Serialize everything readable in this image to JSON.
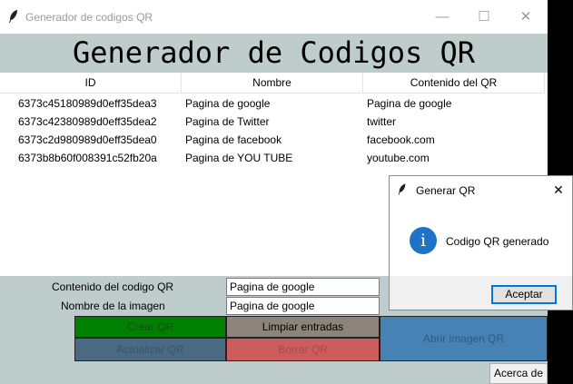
{
  "window": {
    "title": "Generador de codigos QR",
    "controls": {
      "minimize": "—",
      "maximize": "☐",
      "close": "✕"
    }
  },
  "header": {
    "title": "Generador de Codigos QR"
  },
  "table": {
    "columns": [
      "ID",
      "Nombre",
      "Contenido del QR"
    ],
    "rows": [
      [
        "6373c45180989d0eff35dea3",
        "Pagina de google",
        "Pagina de google"
      ],
      [
        "6373c42380989d0eff35dea2",
        "Pagina de Twitter",
        "twitter"
      ],
      [
        "6373c2d980989d0eff35dea0",
        "Pagina de facebook",
        "facebook.com"
      ],
      [
        "6373b8b60f008391c52fb20a",
        "Pagina de YOU TUBE",
        "youtube.com"
      ]
    ]
  },
  "form": {
    "content_label": "Contenido del codigo QR",
    "content_value": "Pagina de google",
    "name_label": "Nombre de la imagen",
    "name_value": "Pagina de google"
  },
  "buttons": {
    "create": "Crear QR",
    "clear": "Limpiar entradas",
    "open_image": "Abrir imagen QR",
    "update": "Actualizar QR",
    "delete": "Borrar QR",
    "about": "Acerca de"
  },
  "dialog": {
    "title": "Generar QR",
    "message": "Codigo QR generado",
    "ok": "Aceptar",
    "close": "✕",
    "info_glyph": "i"
  },
  "colors": {
    "create_bg": "#008000",
    "clear_bg": "#8c847a",
    "open_bg": "#4682b4",
    "update_bg": "#4a6983",
    "delete_bg": "#cd5c5c",
    "header_bg": "#bfcccc",
    "info_blue": "#1e72c8"
  },
  "icons": {
    "app": "feather-icon",
    "dialog_app": "feather-icon",
    "dialog_info": "info-icon"
  }
}
